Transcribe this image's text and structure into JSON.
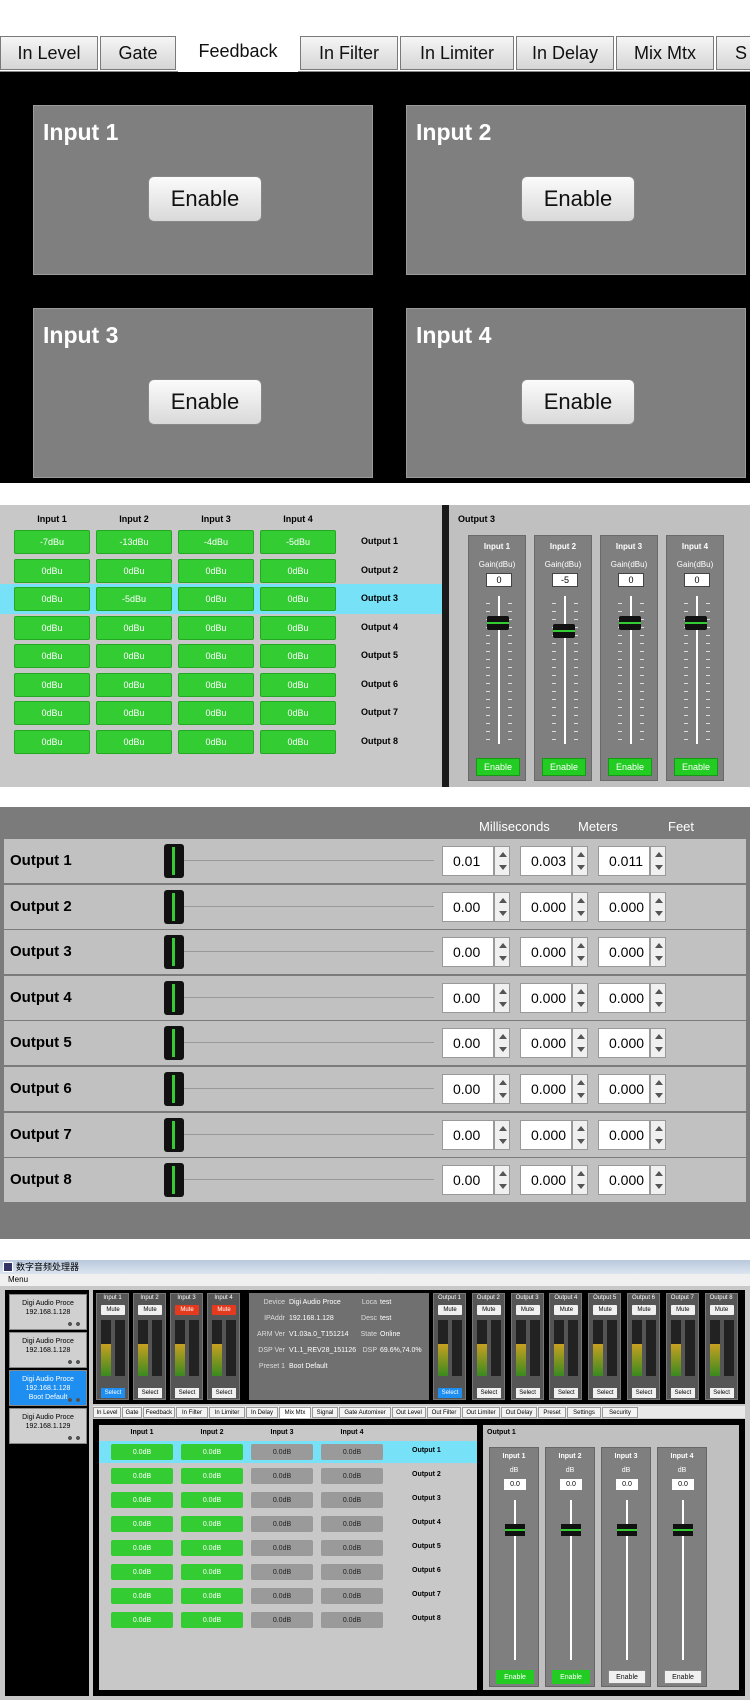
{
  "s1": {
    "tabs": [
      "In Level",
      "Gate",
      "Feedback",
      "In Filter",
      "In Limiter",
      "In Delay",
      "Mix Mtx",
      "S"
    ],
    "active_tab": "Feedback",
    "panels": [
      {
        "title": "Input 1",
        "button": "Enable"
      },
      {
        "title": "Input 2",
        "button": "Enable"
      },
      {
        "title": "Input 3",
        "button": "Enable"
      },
      {
        "title": "Input 4",
        "button": "Enable"
      }
    ]
  },
  "s2": {
    "inputs": [
      "Input 1",
      "Input 2",
      "Input 3",
      "Input 4"
    ],
    "rows": [
      {
        "label": "Output 1",
        "cells": [
          "-7dBu",
          "-13dBu",
          "-4dBu",
          "-5dBu"
        ]
      },
      {
        "label": "Output 2",
        "cells": [
          "0dBu",
          "0dBu",
          "0dBu",
          "0dBu"
        ]
      },
      {
        "label": "Output 3",
        "cells": [
          "0dBu",
          "-5dBu",
          "0dBu",
          "0dBu"
        ]
      },
      {
        "label": "Output 4",
        "cells": [
          "0dBu",
          "0dBu",
          "0dBu",
          "0dBu"
        ]
      },
      {
        "label": "Output 5",
        "cells": [
          "0dBu",
          "0dBu",
          "0dBu",
          "0dBu"
        ]
      },
      {
        "label": "Output 6",
        "cells": [
          "0dBu",
          "0dBu",
          "0dBu",
          "0dBu"
        ]
      },
      {
        "label": "Output 7",
        "cells": [
          "0dBu",
          "0dBu",
          "0dBu",
          "0dBu"
        ]
      },
      {
        "label": "Output 8",
        "cells": [
          "0dBu",
          "0dBu",
          "0dBu",
          "0dBu"
        ]
      }
    ],
    "selected_row": 2,
    "fader_title": "Output 3",
    "faders": [
      {
        "name": "Input 1",
        "gain_label": "Gain(dBu)",
        "value": "0",
        "level": 0,
        "button": "Enable"
      },
      {
        "name": "Input 2",
        "gain_label": "Gain(dBu)",
        "value": "-5",
        "level": -5,
        "button": "Enable"
      },
      {
        "name": "Input 3",
        "gain_label": "Gain(dBu)",
        "value": "0",
        "level": 0,
        "button": "Enable"
      },
      {
        "name": "Input 4",
        "gain_label": "Gain(dBu)",
        "value": "0",
        "level": 0,
        "button": "Enable"
      }
    ]
  },
  "s3": {
    "headers": [
      "Milliseconds",
      "Meters",
      "Feet"
    ],
    "rows": [
      {
        "label": "Output 1",
        "ms": "0.01",
        "m": "0.003",
        "ft": "0.011"
      },
      {
        "label": "Output 2",
        "ms": "0.00",
        "m": "0.000",
        "ft": "0.000"
      },
      {
        "label": "Output 3",
        "ms": "0.00",
        "m": "0.000",
        "ft": "0.000"
      },
      {
        "label": "Output 4",
        "ms": "0.00",
        "m": "0.000",
        "ft": "0.000"
      },
      {
        "label": "Output 5",
        "ms": "0.00",
        "m": "0.000",
        "ft": "0.000"
      },
      {
        "label": "Output 6",
        "ms": "0.00",
        "m": "0.000",
        "ft": "0.000"
      },
      {
        "label": "Output 7",
        "ms": "0.00",
        "m": "0.000",
        "ft": "0.000"
      },
      {
        "label": "Output 8",
        "ms": "0.00",
        "m": "0.000",
        "ft": "0.000"
      }
    ]
  },
  "s4": {
    "title": "数字音频处理器",
    "menu": "Menu",
    "devices": [
      {
        "name": "Digi Audio Proce",
        "ip": "192.168.1.128",
        "extra": ""
      },
      {
        "name": "Digi Audio Proce",
        "ip": "192.168.1.128",
        "extra": ""
      },
      {
        "name": "Digi Audio Proce",
        "ip": "192.168.1.128",
        "extra": "Boot Default"
      },
      {
        "name": "Digi Audio Proce",
        "ip": "192.168.1.129",
        "extra": ""
      }
    ],
    "inputs": [
      {
        "name": "Input 1",
        "mute": "Mute",
        "select": "Select",
        "muted": false,
        "selected": true
      },
      {
        "name": "Input 2",
        "mute": "Mute",
        "select": "Select",
        "muted": false,
        "selected": false
      },
      {
        "name": "Input 3",
        "mute": "Mute",
        "select": "Select",
        "muted": true,
        "selected": false
      },
      {
        "name": "Input 4",
        "mute": "Mute",
        "select": "Select",
        "muted": true,
        "selected": false
      }
    ],
    "outputs": [
      {
        "name": "Output 1",
        "mute": "Mute",
        "select": "Select",
        "selected": true
      },
      {
        "name": "Output 2",
        "mute": "Mute",
        "select": "Select",
        "selected": false
      },
      {
        "name": "Output 3",
        "mute": "Mute",
        "select": "Select",
        "selected": false
      },
      {
        "name": "Output 4",
        "mute": "Mute",
        "select": "Select",
        "selected": false
      },
      {
        "name": "Output 5",
        "mute": "Mute",
        "select": "Select",
        "selected": false
      },
      {
        "name": "Output 6",
        "mute": "Mute",
        "select": "Select",
        "selected": false
      },
      {
        "name": "Output 7",
        "mute": "Mute",
        "select": "Select",
        "selected": false
      },
      {
        "name": "Output 8",
        "mute": "Mute",
        "select": "Select",
        "selected": false
      }
    ],
    "info": [
      {
        "k": "Device",
        "v": "Digi Audio Proce"
      },
      {
        "k": "IPAddr",
        "v": "192.168.1.128"
      },
      {
        "k": "ARM Ver",
        "v": "V1.03a.0_T151214"
      },
      {
        "k": "DSP Ver",
        "v": "V1.1_REV28_151126"
      },
      {
        "k": "Preset 1",
        "v": "Boot Default"
      }
    ],
    "info2": [
      {
        "k": "Loca",
        "v": "test"
      },
      {
        "k": "Desc",
        "v": "test"
      },
      {
        "k": "State",
        "v": "Online"
      },
      {
        "k": "DSP",
        "v": "69.6%,74.0%"
      }
    ],
    "tabs": [
      "In Level",
      "Gate",
      "Feedback",
      "In Filter",
      "In Limiter",
      "In Delay",
      "Mix Mtx",
      "Signal",
      "Gate Automixer",
      "Out Level",
      "Out Filter",
      "Out Limiter",
      "Out Delay",
      "Preset",
      "Settings",
      "Security"
    ],
    "active_tab": "Mix Mtx",
    "matrix_inputs": [
      "Input 1",
      "Input 2",
      "Input 3",
      "Input 4"
    ],
    "matrix_rows": [
      {
        "label": "Output 1",
        "cells": [
          "0.0dB",
          "0.0dB",
          "0.0dB",
          "0.0dB"
        ]
      },
      {
        "label": "Output 2",
        "cells": [
          "0.0dB",
          "0.0dB",
          "0.0dB",
          "0.0dB"
        ]
      },
      {
        "label": "Output 3",
        "cells": [
          "0.0dB",
          "0.0dB",
          "0.0dB",
          "0.0dB"
        ]
      },
      {
        "label": "Output 4",
        "cells": [
          "0.0dB",
          "0.0dB",
          "0.0dB",
          "0.0dB"
        ]
      },
      {
        "label": "Output 5",
        "cells": [
          "0.0dB",
          "0.0dB",
          "0.0dB",
          "0.0dB"
        ]
      },
      {
        "label": "Output 6",
        "cells": [
          "0.0dB",
          "0.0dB",
          "0.0dB",
          "0.0dB"
        ]
      },
      {
        "label": "Output 7",
        "cells": [
          "0.0dB",
          "0.0dB",
          "0.0dB",
          "0.0dB"
        ]
      },
      {
        "label": "Output 8",
        "cells": [
          "0.0dB",
          "0.0dB",
          "0.0dB",
          "0.0dB"
        ]
      }
    ],
    "enabled_inputs": [
      true,
      true,
      false,
      false
    ],
    "fader_title": "Output 1",
    "faders": [
      {
        "name": "Input 1",
        "unit": "dB",
        "value": "0.0",
        "button": "Enable",
        "enabled": true
      },
      {
        "name": "Input 2",
        "unit": "dB",
        "value": "0.0",
        "button": "Enable",
        "enabled": true
      },
      {
        "name": "Input 3",
        "unit": "dB",
        "value": "0.0",
        "button": "Enable",
        "enabled": false
      },
      {
        "name": "Input 4",
        "unit": "dB",
        "value": "0.0",
        "button": "Enable",
        "enabled": false
      }
    ],
    "colors": {
      "green": "#33cc33",
      "red": "#e43b1f",
      "blue": "#1e8ef0",
      "cyan": "#77e1f8"
    }
  }
}
